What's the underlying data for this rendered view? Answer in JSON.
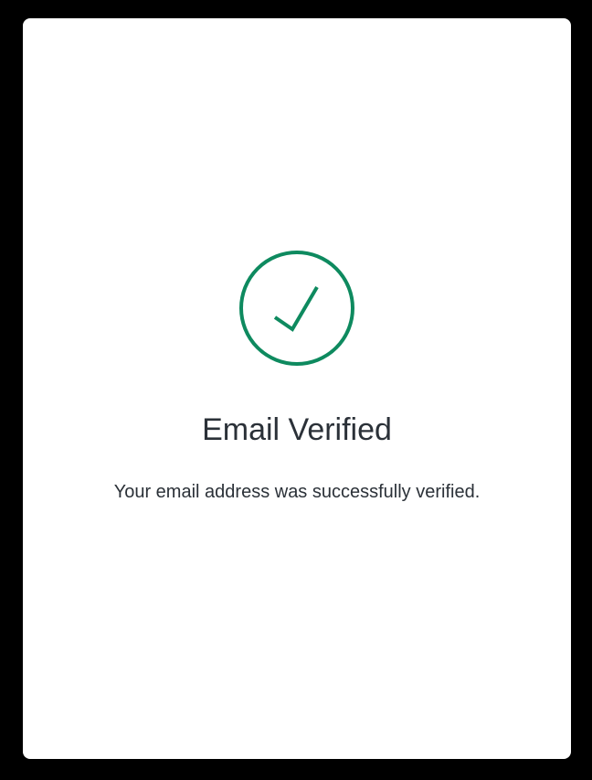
{
  "verification": {
    "title": "Email Verified",
    "message": "Your email address was successfully verified."
  },
  "icon": {
    "name": "check-circle-icon",
    "color": "#0e8a5f"
  },
  "theme": {
    "backdrop": "#000000",
    "card": "#ffffff",
    "text": "#2b3138"
  }
}
